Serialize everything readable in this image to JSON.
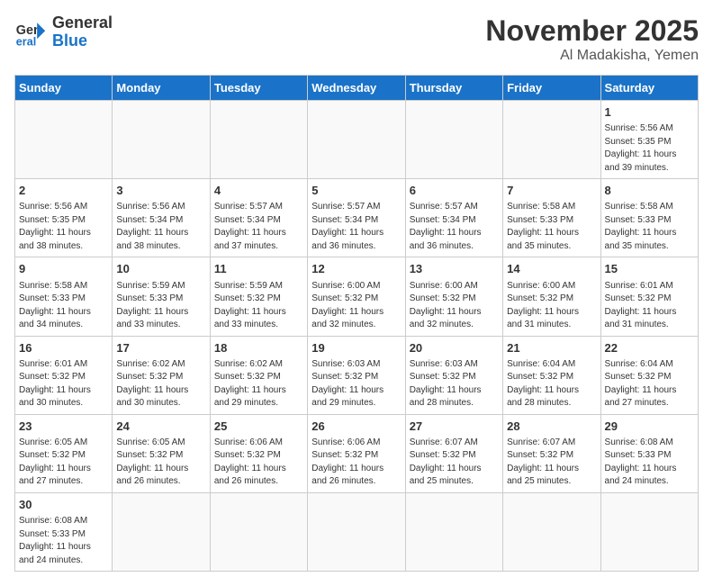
{
  "logo": {
    "line1": "General",
    "line2": "Blue"
  },
  "header": {
    "month": "November 2025",
    "location": "Al Madakisha, Yemen"
  },
  "weekdays": [
    "Sunday",
    "Monday",
    "Tuesday",
    "Wednesday",
    "Thursday",
    "Friday",
    "Saturday"
  ],
  "weeks": [
    [
      {
        "day": "",
        "info": ""
      },
      {
        "day": "",
        "info": ""
      },
      {
        "day": "",
        "info": ""
      },
      {
        "day": "",
        "info": ""
      },
      {
        "day": "",
        "info": ""
      },
      {
        "day": "",
        "info": ""
      },
      {
        "day": "1",
        "info": "Sunrise: 5:56 AM\nSunset: 5:35 PM\nDaylight: 11 hours\nand 39 minutes."
      }
    ],
    [
      {
        "day": "2",
        "info": "Sunrise: 5:56 AM\nSunset: 5:35 PM\nDaylight: 11 hours\nand 38 minutes."
      },
      {
        "day": "3",
        "info": "Sunrise: 5:56 AM\nSunset: 5:34 PM\nDaylight: 11 hours\nand 38 minutes."
      },
      {
        "day": "4",
        "info": "Sunrise: 5:57 AM\nSunset: 5:34 PM\nDaylight: 11 hours\nand 37 minutes."
      },
      {
        "day": "5",
        "info": "Sunrise: 5:57 AM\nSunset: 5:34 PM\nDaylight: 11 hours\nand 36 minutes."
      },
      {
        "day": "6",
        "info": "Sunrise: 5:57 AM\nSunset: 5:34 PM\nDaylight: 11 hours\nand 36 minutes."
      },
      {
        "day": "7",
        "info": "Sunrise: 5:58 AM\nSunset: 5:33 PM\nDaylight: 11 hours\nand 35 minutes."
      },
      {
        "day": "8",
        "info": "Sunrise: 5:58 AM\nSunset: 5:33 PM\nDaylight: 11 hours\nand 35 minutes."
      }
    ],
    [
      {
        "day": "9",
        "info": "Sunrise: 5:58 AM\nSunset: 5:33 PM\nDaylight: 11 hours\nand 34 minutes."
      },
      {
        "day": "10",
        "info": "Sunrise: 5:59 AM\nSunset: 5:33 PM\nDaylight: 11 hours\nand 33 minutes."
      },
      {
        "day": "11",
        "info": "Sunrise: 5:59 AM\nSunset: 5:32 PM\nDaylight: 11 hours\nand 33 minutes."
      },
      {
        "day": "12",
        "info": "Sunrise: 6:00 AM\nSunset: 5:32 PM\nDaylight: 11 hours\nand 32 minutes."
      },
      {
        "day": "13",
        "info": "Sunrise: 6:00 AM\nSunset: 5:32 PM\nDaylight: 11 hours\nand 32 minutes."
      },
      {
        "day": "14",
        "info": "Sunrise: 6:00 AM\nSunset: 5:32 PM\nDaylight: 11 hours\nand 31 minutes."
      },
      {
        "day": "15",
        "info": "Sunrise: 6:01 AM\nSunset: 5:32 PM\nDaylight: 11 hours\nand 31 minutes."
      }
    ],
    [
      {
        "day": "16",
        "info": "Sunrise: 6:01 AM\nSunset: 5:32 PM\nDaylight: 11 hours\nand 30 minutes."
      },
      {
        "day": "17",
        "info": "Sunrise: 6:02 AM\nSunset: 5:32 PM\nDaylight: 11 hours\nand 30 minutes."
      },
      {
        "day": "18",
        "info": "Sunrise: 6:02 AM\nSunset: 5:32 PM\nDaylight: 11 hours\nand 29 minutes."
      },
      {
        "day": "19",
        "info": "Sunrise: 6:03 AM\nSunset: 5:32 PM\nDaylight: 11 hours\nand 29 minutes."
      },
      {
        "day": "20",
        "info": "Sunrise: 6:03 AM\nSunset: 5:32 PM\nDaylight: 11 hours\nand 28 minutes."
      },
      {
        "day": "21",
        "info": "Sunrise: 6:04 AM\nSunset: 5:32 PM\nDaylight: 11 hours\nand 28 minutes."
      },
      {
        "day": "22",
        "info": "Sunrise: 6:04 AM\nSunset: 5:32 PM\nDaylight: 11 hours\nand 27 minutes."
      }
    ],
    [
      {
        "day": "23",
        "info": "Sunrise: 6:05 AM\nSunset: 5:32 PM\nDaylight: 11 hours\nand 27 minutes."
      },
      {
        "day": "24",
        "info": "Sunrise: 6:05 AM\nSunset: 5:32 PM\nDaylight: 11 hours\nand 26 minutes."
      },
      {
        "day": "25",
        "info": "Sunrise: 6:06 AM\nSunset: 5:32 PM\nDaylight: 11 hours\nand 26 minutes."
      },
      {
        "day": "26",
        "info": "Sunrise: 6:06 AM\nSunset: 5:32 PM\nDaylight: 11 hours\nand 26 minutes."
      },
      {
        "day": "27",
        "info": "Sunrise: 6:07 AM\nSunset: 5:32 PM\nDaylight: 11 hours\nand 25 minutes."
      },
      {
        "day": "28",
        "info": "Sunrise: 6:07 AM\nSunset: 5:32 PM\nDaylight: 11 hours\nand 25 minutes."
      },
      {
        "day": "29",
        "info": "Sunrise: 6:08 AM\nSunset: 5:33 PM\nDaylight: 11 hours\nand 24 minutes."
      }
    ],
    [
      {
        "day": "30",
        "info": "Sunrise: 6:08 AM\nSunset: 5:33 PM\nDaylight: 11 hours\nand 24 minutes."
      },
      {
        "day": "",
        "info": ""
      },
      {
        "day": "",
        "info": ""
      },
      {
        "day": "",
        "info": ""
      },
      {
        "day": "",
        "info": ""
      },
      {
        "day": "",
        "info": ""
      },
      {
        "day": "",
        "info": ""
      }
    ]
  ]
}
